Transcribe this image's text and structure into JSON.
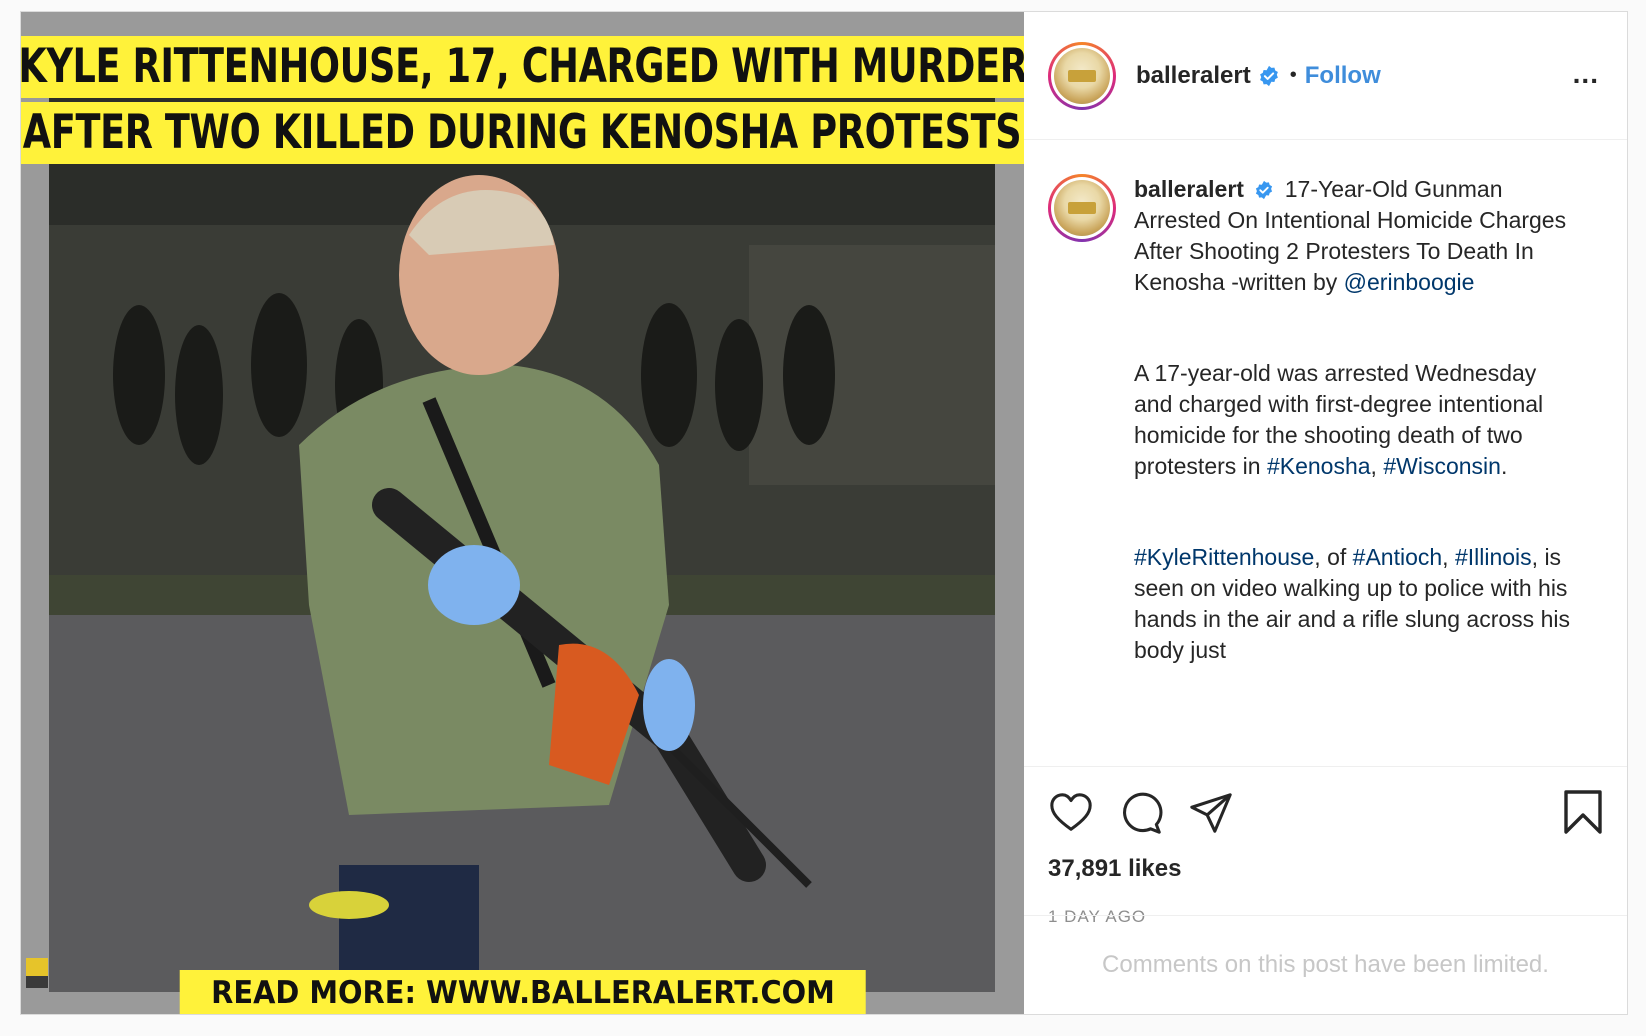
{
  "media": {
    "headline_line1": "KYLE RITTENHOUSE, 17, CHARGED WITH MURDER",
    "headline_line2": "AFTER TWO KILLED DURING KENOSHA PROTESTS",
    "footer": "READ MORE: WWW.BALLERALERT.COM"
  },
  "header": {
    "username": "balleralert",
    "separator": "•",
    "follow_label": "Follow",
    "more_label": "..."
  },
  "caption": {
    "username": "balleralert",
    "intro": "17-Year-Old Gunman Arrested On Intentional Homicide Charges After Shooting 2 Protesters To Death In Kenosha -written by",
    "author_mention": "@erinboogie",
    "para2_text": "A 17-year-old was arrested Wednesday and charged with first-degree intentional homicide for the shooting death of two protesters in",
    "tag_kenosha": "#Kenosha",
    "comma": ",",
    "tag_wisconsin": "#Wisconsin",
    "period": ".",
    "tag_kyle": "#KyleRittenhouse",
    "of_text": ", of",
    "tag_antioch": "#Antioch",
    "comma2": ",",
    "tag_illinois": "#Illinois",
    "para3_text": ", is seen on video walking up to police with his hands in the air and a rifle slung across his body just"
  },
  "actions": {
    "likes": "37,891 likes",
    "time_ago": "1 DAY AGO"
  },
  "comments": {
    "limited_notice": "Comments on this post have been limited."
  },
  "colors": {
    "follow_blue": "#3f8ddb",
    "link_blue": "#00376b",
    "verified_blue": "#3897f0",
    "banner_yellow": "#fff23a"
  }
}
